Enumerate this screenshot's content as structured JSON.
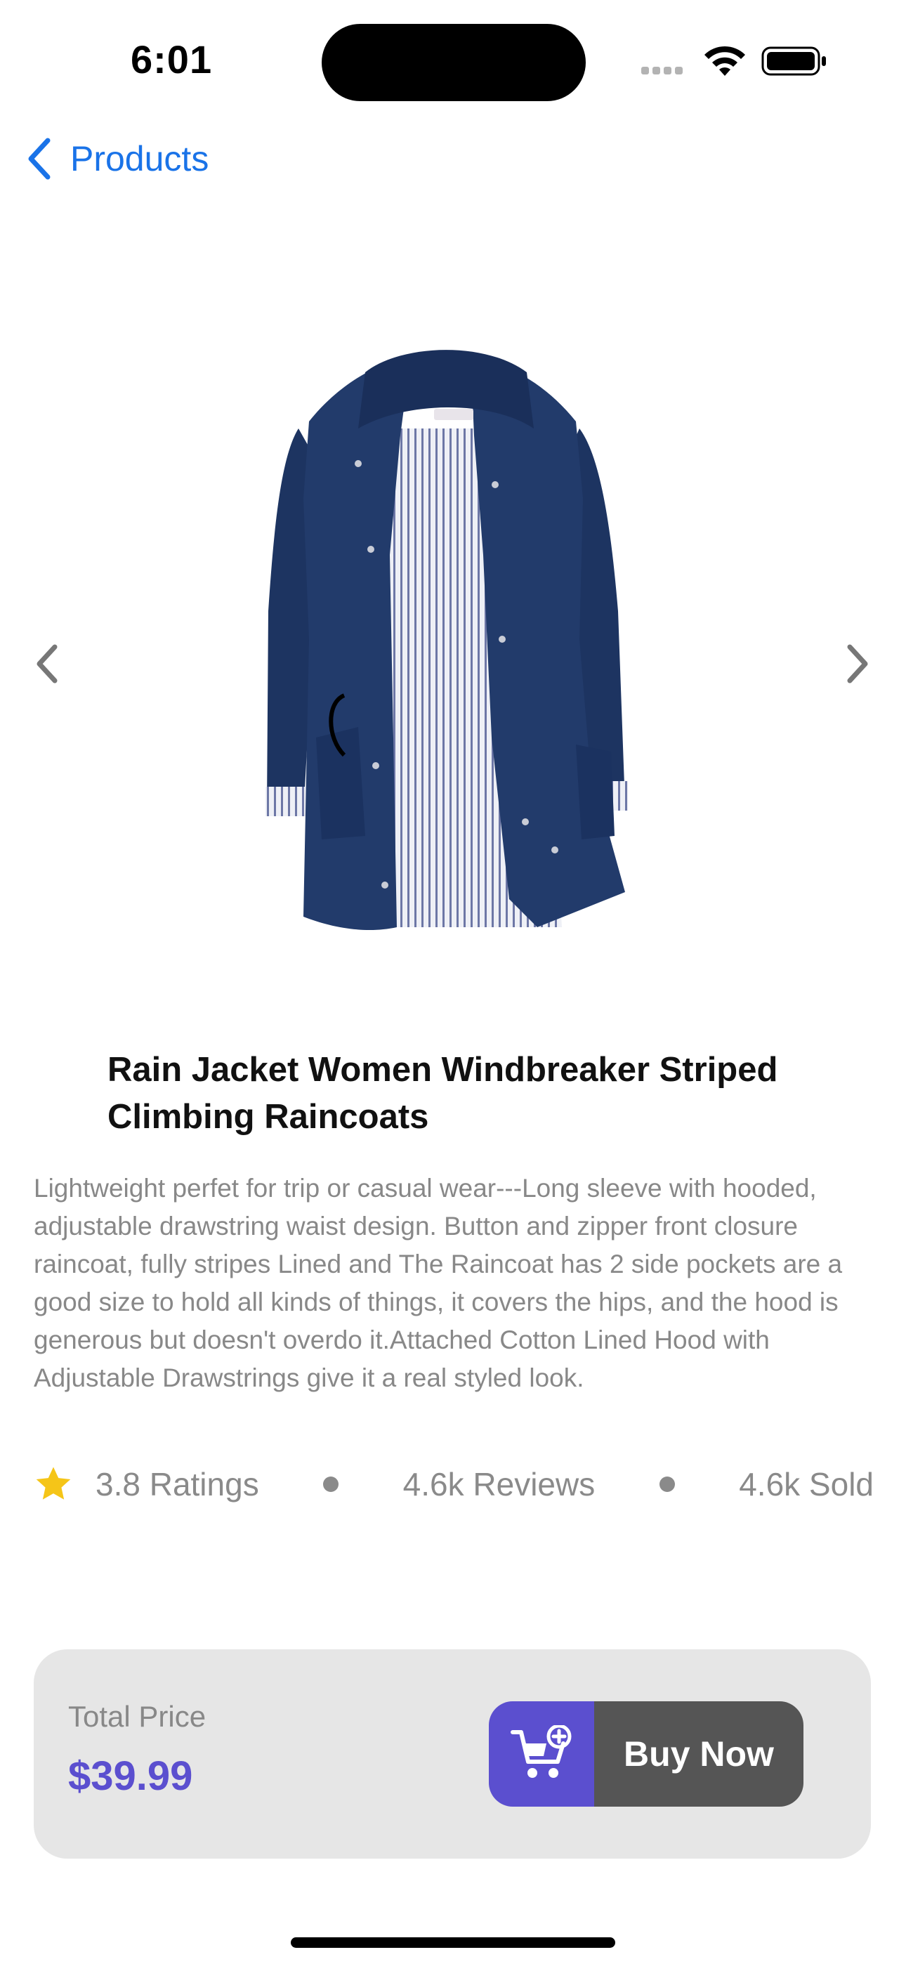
{
  "status_bar": {
    "time": "6:01"
  },
  "nav": {
    "back_label": "Products"
  },
  "product": {
    "title": "Rain Jacket Women Windbreaker Striped Climbing Raincoats",
    "description": "Lightweight perfet for trip or casual wear---Long sleeve with hooded, adjustable drawstring waist design. Button and zipper front closure raincoat, fully stripes Lined and The Raincoat has 2 side pockets are a good size to hold all kinds of things, it covers the hips, and the hood is generous but doesn't overdo it.Attached Cotton Lined Hood with Adjustable Drawstrings give it a real styled look.",
    "image_icon": "navy-rain-jacket-image"
  },
  "stats": {
    "ratings": "3.8 Ratings",
    "reviews": "4.6k Reviews",
    "sold": "4.6k Sold"
  },
  "purchase": {
    "price_label": "Total Price",
    "price": "$39.99",
    "buy_label": "Buy Now",
    "cart_icon": "cart-plus-icon"
  },
  "colors": {
    "accent": "#5b4fcf",
    "link": "#1a73e8",
    "star": "#f5c518",
    "button_dark": "#555555",
    "card_bg": "#e6e6e6"
  }
}
